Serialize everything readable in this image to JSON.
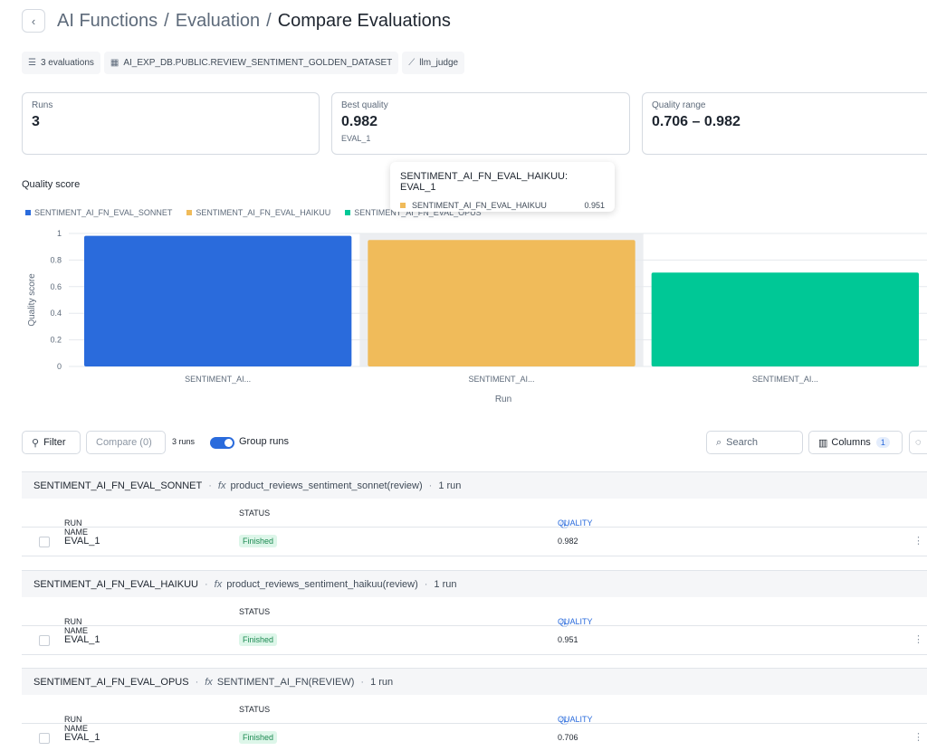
{
  "breadcrumb": {
    "level1": "AI Functions",
    "level2": "Evaluation",
    "current": "Compare Evaluations",
    "sep": "/"
  },
  "meta": [
    {
      "icon": "list-icon",
      "glyph": "☰",
      "label": "3 evaluations"
    },
    {
      "icon": "table-icon",
      "glyph": "▦",
      "label": "AI_EXP_DB.PUBLIC.REVIEW_SENTIMENT_GOLDEN_DATASET"
    },
    {
      "icon": "line-chart-icon",
      "glyph": "⟋",
      "label": "llm_judge"
    }
  ],
  "stats": [
    {
      "label": "Runs",
      "value": "3",
      "sub": ""
    },
    {
      "label": "Best quality",
      "value": "0.982",
      "sub": "EVAL_1"
    },
    {
      "label": "Quality range",
      "value": "0.706 – 0.982",
      "sub": ""
    }
  ],
  "chart_title": "Quality score",
  "chart_data": {
    "type": "bar",
    "categories": [
      "SENTIMENT_AI...",
      "SENTIMENT_AI...",
      "SENTIMENT_AI..."
    ],
    "series": [
      {
        "name": "SENTIMENT_AI_FN_EVAL_SONNET",
        "color": "#2a6bdc",
        "values": [
          0.982
        ]
      },
      {
        "name": "SENTIMENT_AI_FN_EVAL_HAIKUU",
        "color": "#f0bb5a",
        "values": [
          0.951
        ]
      },
      {
        "name": "SENTIMENT_AI_FN_EVAL_OPUS",
        "color": "#00c896",
        "values": [
          0.706
        ]
      }
    ],
    "values": [
      0.982,
      0.951,
      0.706
    ],
    "xlabel": "Run",
    "ylabel": "Quality score",
    "ylim": [
      0,
      1
    ],
    "yticks": [
      "0",
      "0.2",
      "0.4",
      "0.6",
      "0.8",
      "1"
    ],
    "legend": "top-left",
    "grid": true,
    "highlighted_index": 1
  },
  "tooltip": {
    "title": "SENTIMENT_AI_FN_EVAL_HAIKUU: EVAL_1",
    "series": "SENTIMENT_AI_FN_EVAL_HAIKUU",
    "value": "0.951"
  },
  "toolbar": {
    "filter_label": "Filter",
    "compare_label": "Compare (0)",
    "runs_count": "3 runs",
    "group_runs_label": "Group runs",
    "search_placeholder": "Search",
    "columns_label": "Columns",
    "columns_count": "1"
  },
  "table_headers": {
    "run_name": "RUN NAME",
    "status": "STATUS",
    "quality": "QUALITY"
  },
  "groups": [
    {
      "name": "SENTIMENT_AI_FN_EVAL_SONNET",
      "function": "product_reviews_sentiment_sonnet(review)",
      "runs_label": "1 run",
      "rows": [
        {
          "run_name": "EVAL_1",
          "status": "Finished",
          "quality": "0.982"
        }
      ]
    },
    {
      "name": "SENTIMENT_AI_FN_EVAL_HAIKUU",
      "function": "product_reviews_sentiment_haikuu(review)",
      "runs_label": "1 run",
      "rows": [
        {
          "run_name": "EVAL_1",
          "status": "Finished",
          "quality": "0.951"
        }
      ]
    },
    {
      "name": "SENTIMENT_AI_FN_EVAL_OPUS",
      "function": "SENTIMENT_AI_FN(REVIEW)",
      "runs_label": "1 run",
      "rows": [
        {
          "run_name": "EVAL_1",
          "status": "Finished",
          "quality": "0.706"
        }
      ]
    }
  ]
}
